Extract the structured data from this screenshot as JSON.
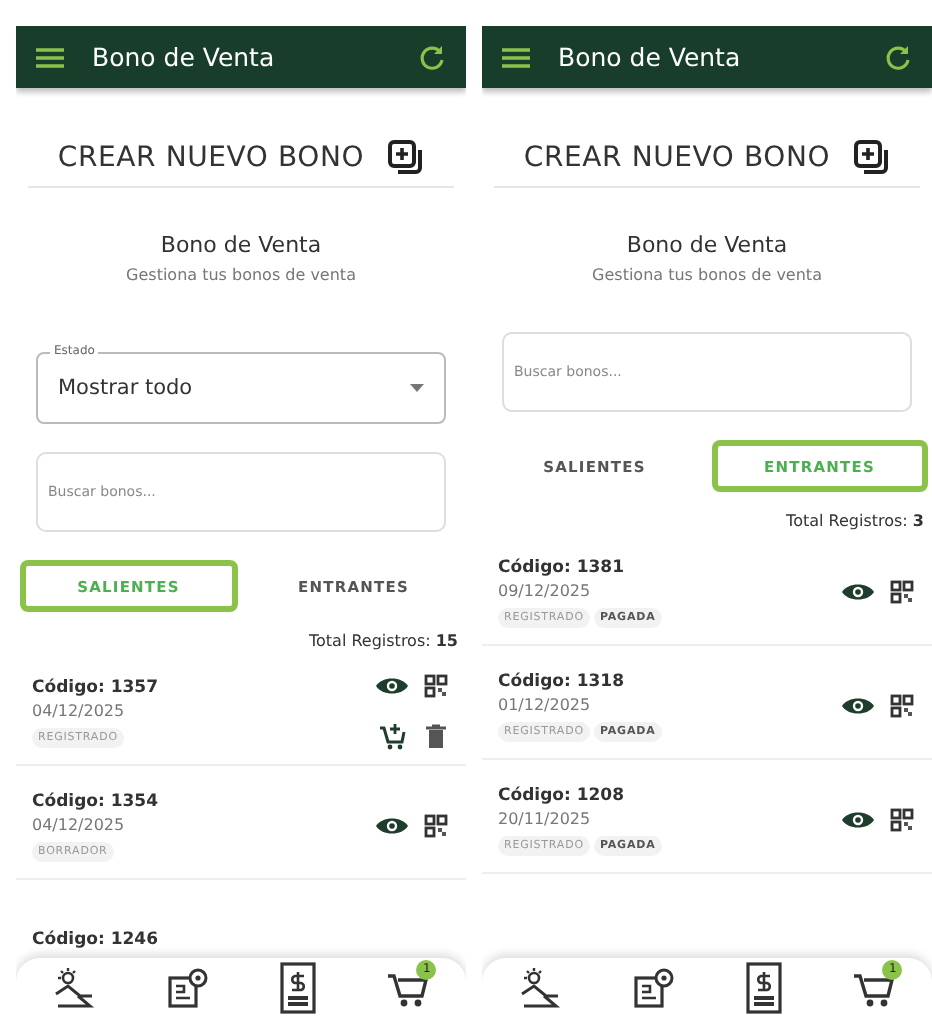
{
  "screens": [
    {
      "header": {
        "title": "Bono de Venta"
      },
      "create_button": "CREAR NUEVO BONO",
      "title": "Bono de Venta",
      "subtitle": "Gestiona tus bonos de venta",
      "estado_select": {
        "label": "Estado",
        "value": "Mostrar todo"
      },
      "search": {
        "placeholder": "Buscar bonos..."
      },
      "tabs": [
        {
          "label": "SALIENTES",
          "selected": true
        },
        {
          "label": "ENTRANTES",
          "selected": false
        }
      ],
      "total": {
        "label": "Total Registros:",
        "value": "15"
      },
      "records": [
        {
          "code": "Código: 1357",
          "date": "04/12/2025",
          "tags": [
            {
              "label": "REGISTRADO",
              "kind": "status"
            }
          ],
          "actions": [
            {
              "kind": "view"
            },
            {
              "kind": "qr"
            },
            {
              "kind": "cart"
            },
            {
              "kind": "delete"
            }
          ]
        },
        {
          "code": "Código: 1354",
          "date": "04/12/2025",
          "tags": [
            {
              "label": "BORRADOR",
              "kind": "status"
            }
          ],
          "actions": [
            {
              "kind": "view"
            },
            {
              "kind": "qr"
            }
          ]
        },
        {
          "code": "Código: 1246"
        }
      ],
      "nav": {
        "cart_badge": "1"
      }
    },
    {
      "header": {
        "title": "Bono de Venta"
      },
      "create_button": "CREAR NUEVO BONO",
      "title": "Bono de Venta",
      "subtitle": "Gestiona tus bonos de venta",
      "search": {
        "placeholder": "Buscar bonos..."
      },
      "tabs": [
        {
          "label": "SALIENTES",
          "selected": false
        },
        {
          "label": "ENTRANTES",
          "selected": true
        }
      ],
      "total": {
        "label": "Total Registros:",
        "value": "3"
      },
      "records": [
        {
          "code": "Código: 1381",
          "date": "09/12/2025",
          "tags": [
            {
              "label": "REGISTRADO",
              "kind": "status"
            },
            {
              "label": "PAGADA",
              "kind": "payment"
            }
          ],
          "actions": [
            {
              "kind": "view"
            },
            {
              "kind": "qr"
            }
          ]
        },
        {
          "code": "Código: 1318",
          "date": "01/12/2025",
          "tags": [
            {
              "label": "REGISTRADO",
              "kind": "status"
            },
            {
              "label": "PAGADA",
              "kind": "payment"
            }
          ],
          "actions": [
            {
              "kind": "view"
            },
            {
              "kind": "qr"
            }
          ]
        },
        {
          "code": "Código: 1208",
          "date": "20/11/2025",
          "tags": [
            {
              "label": "REGISTRADO",
              "kind": "status"
            },
            {
              "label": "PAGADA",
              "kind": "payment"
            }
          ],
          "actions": [
            {
              "kind": "view"
            },
            {
              "kind": "qr"
            }
          ]
        }
      ],
      "nav": {
        "cart_badge": "1"
      }
    }
  ]
}
